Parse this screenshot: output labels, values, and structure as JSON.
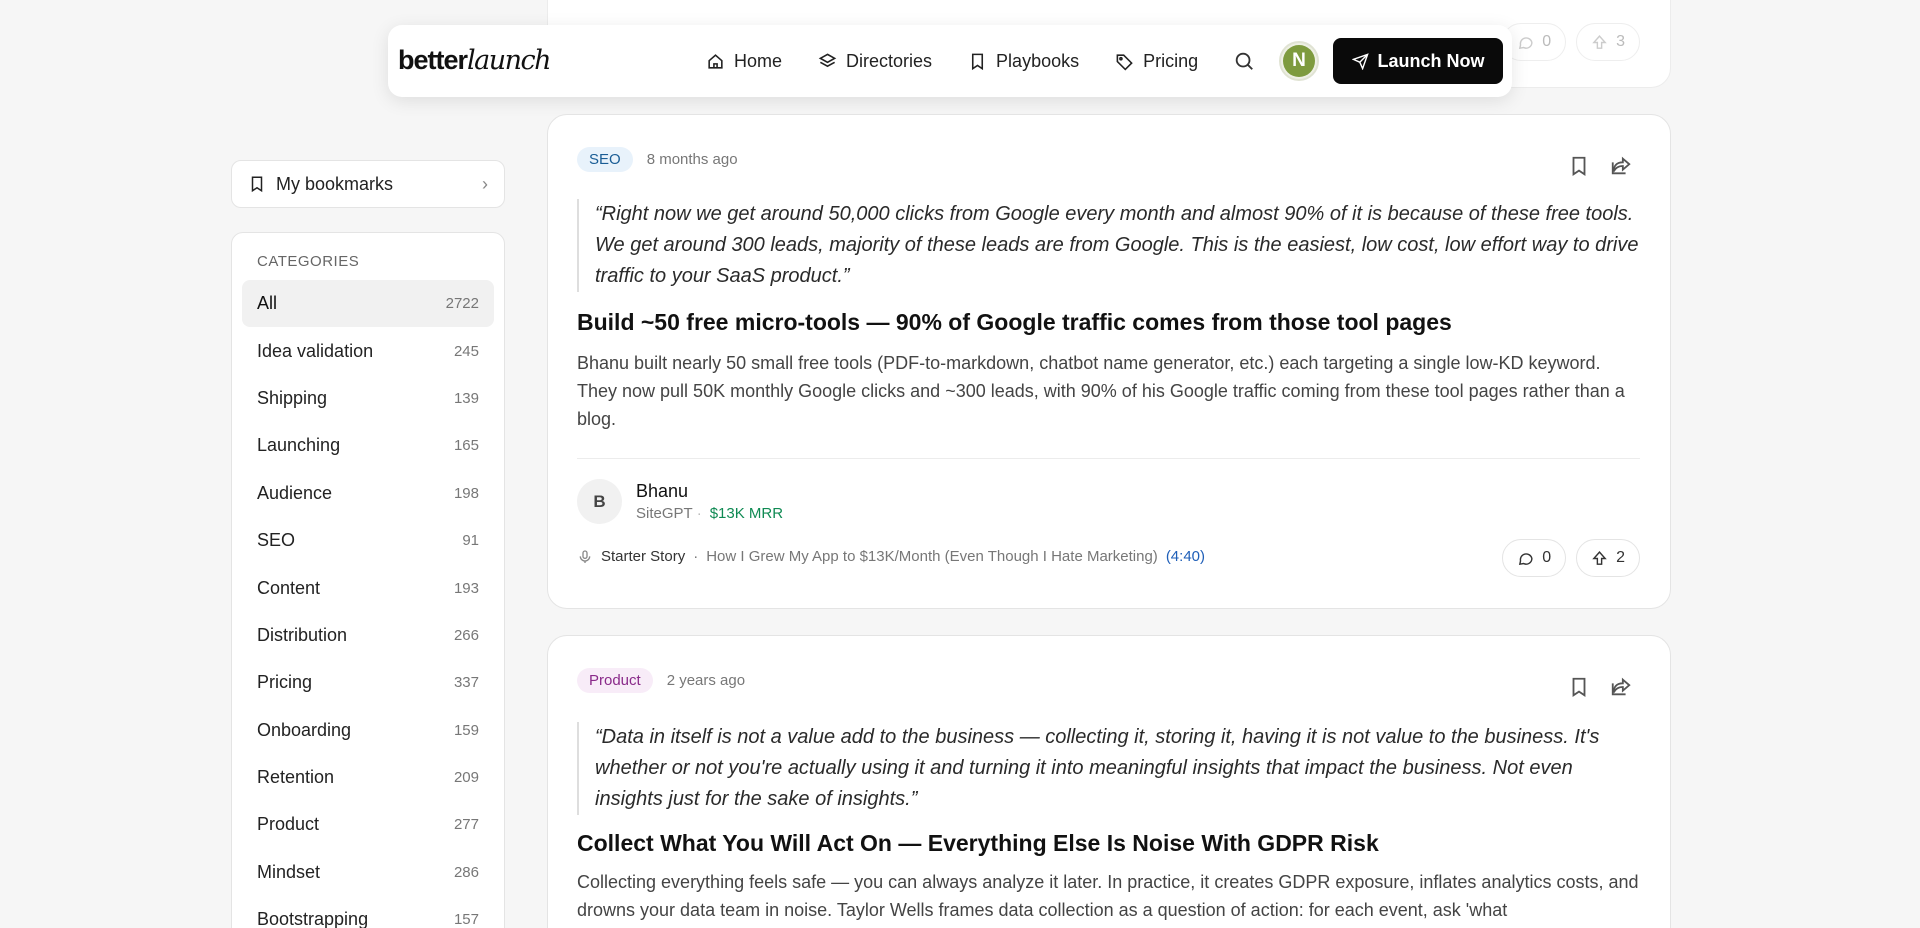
{
  "nav": {
    "logo_bold": "better",
    "logo_italic": "launch",
    "links": [
      {
        "label": "Home",
        "icon": "home-icon"
      },
      {
        "label": "Directories",
        "icon": "layers-icon"
      },
      {
        "label": "Playbooks",
        "icon": "book-icon"
      },
      {
        "label": "Pricing",
        "icon": "tag-icon"
      }
    ],
    "avatar_letter": "N",
    "launch_label": "Launch Now"
  },
  "top_card": {
    "comments": "0",
    "upvotes": "3"
  },
  "sidebar": {
    "bookmarks_label": "My bookmarks",
    "categories_title": "CATEGORIES",
    "categories": [
      {
        "label": "All",
        "count": "2722"
      },
      {
        "label": "Idea validation",
        "count": "245"
      },
      {
        "label": "Shipping",
        "count": "139"
      },
      {
        "label": "Launching",
        "count": "165"
      },
      {
        "label": "Audience",
        "count": "198"
      },
      {
        "label": "SEO",
        "count": "91"
      },
      {
        "label": "Content",
        "count": "193"
      },
      {
        "label": "Distribution",
        "count": "266"
      },
      {
        "label": "Pricing",
        "count": "337"
      },
      {
        "label": "Onboarding",
        "count": "159"
      },
      {
        "label": "Retention",
        "count": "209"
      },
      {
        "label": "Product",
        "count": "277"
      },
      {
        "label": "Mindset",
        "count": "286"
      },
      {
        "label": "Bootstrapping",
        "count": "157"
      }
    ]
  },
  "cards": [
    {
      "tag": "SEO",
      "ago": "8 months ago",
      "quote": "“Right now we get around 50,000 clicks from Google every month and almost 90% of it is because of these free tools. We get around 300 leads, majority of these leads are from Google. This is the easiest, low cost, low effort way to drive traffic to your SaaS product.”",
      "title": "Build ~50 free micro-tools — 90% of Google traffic comes from those tool pages",
      "description": "Bhanu built nearly 50 small free tools (PDF-to-markdown, chatbot name generator, etc.) each targeting a single low-KD keyword. They now pull 50K monthly Google clicks and ~300 leads, with 90% of his Google traffic coming from these tool pages rather than a blog.",
      "author_initial": "B",
      "author_name": "Bhanu",
      "author_company": "SiteGPT",
      "author_mrr": "$13K MRR",
      "source_name": "Starter Story",
      "source_title": "How I Grew My App to $13K/Month (Even Though I Hate Marketing)",
      "source_time": "(4:40)",
      "comments": "0",
      "upvotes": "2"
    },
    {
      "tag": "Product",
      "ago": "2 years ago",
      "quote": "“Data in itself is not a value add to the business — collecting it, storing it, having it is not value to the business. It's whether or not you're actually using it and turning it into meaningful insights that impact the business. Not even insights just for the sake of insights.”",
      "title": "Collect What You Will Act On — Everything Else Is Noise With GDPR Risk",
      "description": "Collecting everything feels safe — you can always analyze it later. In practice, it creates GDPR exposure, inflates analytics costs, and drowns your data team in noise. Taylor Wells frames data collection as a question of action: for each event, ask 'what"
    }
  ],
  "colors": {
    "accent_green": "#0f8a53",
    "link_blue": "#1f5fb8",
    "brand_dark": "#0a0a0a"
  }
}
